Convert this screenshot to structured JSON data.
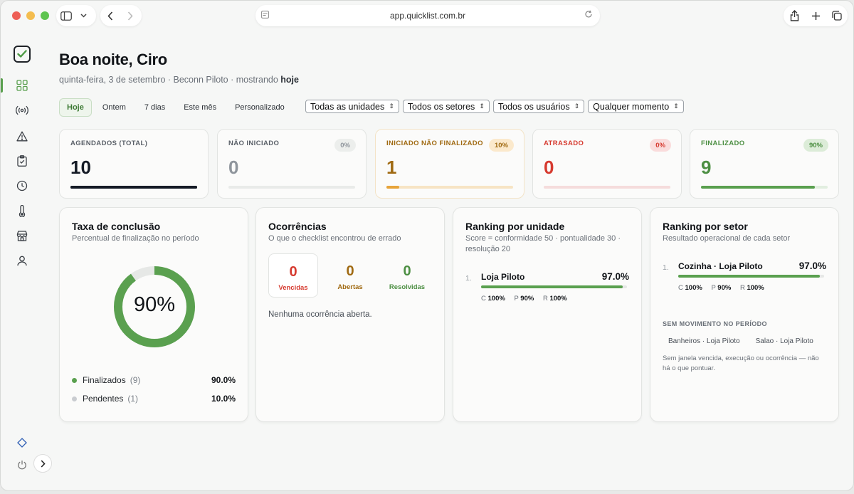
{
  "browser": {
    "url": "app.quicklist.com.br",
    "colors": {
      "close": "#ee5f56",
      "minimize": "#f4bd4f",
      "maximize": "#5ec450"
    }
  },
  "sidebar": {
    "icons": [
      "check-square-logo-icon",
      "grid-icon",
      "broadcast-icon",
      "warning-icon",
      "clipboard-check-icon",
      "clock-icon",
      "thermometer-icon",
      "store-icon",
      "user-icon",
      "diamond-icon",
      "power-icon"
    ]
  },
  "header": {
    "greeting": "Boa noite, Ciro",
    "subtitle_prefix": "quinta-feira, 3 de setembro · Beconn Piloto · mostrando ",
    "subtitle_bold": "hoje"
  },
  "ranges": [
    "Hoje",
    "Ontem",
    "7 dias",
    "Este mês",
    "Personalizado"
  ],
  "filters": [
    "Todas as unidades",
    "Todos os setores",
    "Todos os usuários",
    "Qualquer momento"
  ],
  "kpis": [
    {
      "label": "AGENDADOS (TOTAL)",
      "value": "10",
      "badge": "",
      "fill": 1.0,
      "color": "#151b26",
      "track": "#151b26",
      "badge_bg": "",
      "border": "#e2e4e2"
    },
    {
      "label": "NÃO INICIADO",
      "value": "0",
      "badge": "0%",
      "fill": 0,
      "color": "#8f959c",
      "track": "#e9ebe9",
      "badge_bg": "#eceeec",
      "border": "#e2e4e2"
    },
    {
      "label": "INICIADO NÃO FINALIZADO",
      "value": "1",
      "badge": "10%",
      "fill": 0.1,
      "color": "#a06a12",
      "track": "#f7e4c4",
      "badge_bg": "#fbe9cc",
      "border": "#f3e3c7",
      "fill_color": "#e7a43a"
    },
    {
      "label": "ATRASADO",
      "value": "0",
      "badge": "0%",
      "fill": 0,
      "color": "#d63a2f",
      "track": "#f5dcdc",
      "badge_bg": "#fadcdc",
      "border": "#e2e4e2"
    },
    {
      "label": "FINALIZADO",
      "value": "9",
      "badge": "90%",
      "fill": 0.9,
      "color": "#4d8f43",
      "track": "#e2eee0",
      "badge_bg": "#dcecd8",
      "border": "#e2e4e2",
      "fill_color": "#5aa04f"
    }
  ],
  "conclusao": {
    "title": "Taxa de conclusão",
    "subtitle": "Percentual de finalização no período",
    "percent_label": "90%",
    "percent": 0.9,
    "legend": [
      {
        "label": "Finalizados",
        "count": "(9)",
        "pct": "90.0%",
        "color": "#5aa04f"
      },
      {
        "label": "Pendentes",
        "count": "(1)",
        "pct": "10.0%",
        "color": "#c9ccd0"
      }
    ]
  },
  "ocorrencias": {
    "title": "Ocorrências",
    "subtitle": "O que o checklist encontrou de errado",
    "items": [
      {
        "value": "0",
        "label": "Vencidas",
        "color": "#d63a2f"
      },
      {
        "value": "0",
        "label": "Abertas",
        "color": "#a06a12"
      },
      {
        "value": "0",
        "label": "Resolvidas",
        "color": "#4d8f43"
      }
    ],
    "empty": "Nenhuma ocorrência aberta."
  },
  "ranking_unidade": {
    "title": "Ranking por unidade",
    "subtitle": "Score = conformidade 50 · pontualidade 30 · resolução 20",
    "rows": [
      {
        "index": "1.",
        "name": "Loja Piloto",
        "pct": "97.0%",
        "score": 0.97,
        "c": "100%",
        "p": "90%",
        "r": "100%"
      }
    ]
  },
  "ranking_setor": {
    "title": "Ranking por setor",
    "subtitle": "Resultado operacional de cada setor",
    "rows": [
      {
        "index": "1.",
        "name": "Cozinha · Loja Piloto",
        "pct": "97.0%",
        "score": 0.97,
        "c": "100%",
        "p": "90%",
        "r": "100%"
      }
    ],
    "empty_caption": "SEM MOVIMENTO NO PERÍODO",
    "empty_items": [
      "Banheiros · Loja Piloto",
      "Salao · Loja Piloto"
    ],
    "note": "Sem janela vencida, execução ou ocorrência — não há o que pontuar."
  },
  "rank_letters": {
    "c": "C",
    "p": "P",
    "r": "R"
  }
}
